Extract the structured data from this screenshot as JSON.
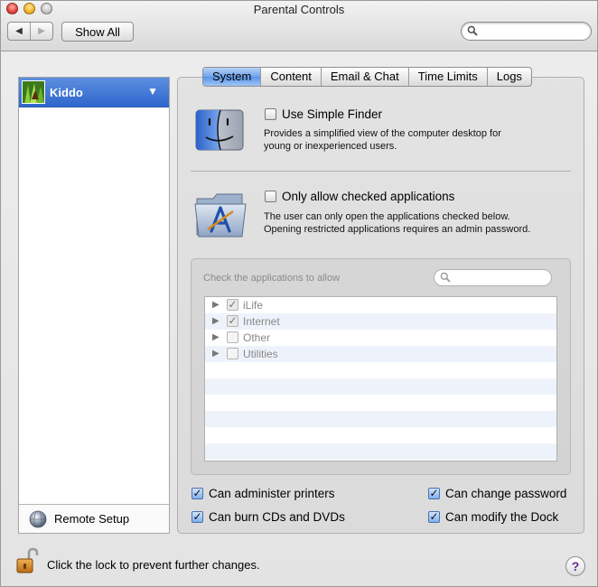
{
  "window": {
    "title": "Parental Controls",
    "show_all_label": "Show All",
    "back_icon": "back-arrow-icon",
    "forward_icon": "forward-arrow-icon",
    "search_value": ""
  },
  "users": {
    "items": [
      {
        "name": "Kiddo",
        "selected": true
      }
    ],
    "remote_setup_label": "Remote Setup"
  },
  "tabs": [
    {
      "label": "System",
      "active": true
    },
    {
      "label": "Content",
      "active": false
    },
    {
      "label": "Email & Chat",
      "active": false
    },
    {
      "label": "Time Limits",
      "active": false
    },
    {
      "label": "Logs",
      "active": false
    }
  ],
  "simple_finder": {
    "label": "Use Simple Finder",
    "checked": false,
    "desc_line1": "Provides a simplified view of the computer desktop for",
    "desc_line2": "young or inexperienced users."
  },
  "only_allow": {
    "label": "Only allow checked applications",
    "checked": false,
    "desc_line1": "The user can only open the applications checked below.",
    "desc_line2": "Opening restricted applications requires an admin password."
  },
  "apps": {
    "label": "Check the applications to allow",
    "search_value": "",
    "items": [
      {
        "name": "iLife",
        "checked": true
      },
      {
        "name": "Internet",
        "checked": true
      },
      {
        "name": "Other",
        "checked": false
      },
      {
        "name": "Utilities",
        "checked": false
      }
    ]
  },
  "options": {
    "administer_printers": {
      "label": "Can administer printers",
      "checked": true
    },
    "burn_cds": {
      "label": "Can burn CDs and DVDs",
      "checked": true
    },
    "change_password": {
      "label": "Can change password",
      "checked": true
    },
    "modify_dock": {
      "label": "Can modify the Dock",
      "checked": true
    }
  },
  "footer": {
    "lock_text": "Click the lock to prevent further changes.",
    "help_label": "?"
  },
  "colors": {
    "selection": "#2e66cc",
    "tab_active": "#6fa3ec"
  }
}
